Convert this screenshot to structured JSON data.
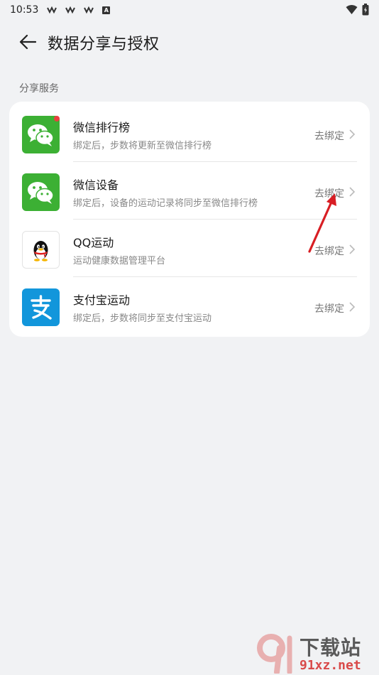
{
  "status_bar": {
    "time": "10:53",
    "badge_letter": "A"
  },
  "header": {
    "title": "数据分享与授权"
  },
  "section": {
    "label": "分享服务"
  },
  "items": [
    {
      "title": "微信排行榜",
      "subtitle": "绑定后，步数将更新至微信排行榜",
      "action": "去绑定",
      "icon": "wechat-icon",
      "has_badge": true
    },
    {
      "title": "微信设备",
      "subtitle": "绑定后，设备的运动记录将同步至微信排行榜",
      "action": "去绑定",
      "icon": "wechat-icon"
    },
    {
      "title": "QQ运动",
      "subtitle": "运动健康数据管理平台",
      "action": "去绑定",
      "icon": "qq-penguin-icon"
    },
    {
      "title": "支付宝运动",
      "subtitle": "绑定后，步数将同步至支付宝运动",
      "action": "去绑定",
      "icon": "alipay-icon"
    }
  ],
  "colors": {
    "wechat_green": "#3cb034",
    "alipay_blue": "#1296db",
    "badge_red": "#e94040",
    "annotation_red": "#d81e24"
  },
  "watermark": {
    "text_top": "下载站",
    "text_bottom": "91xz.net"
  }
}
